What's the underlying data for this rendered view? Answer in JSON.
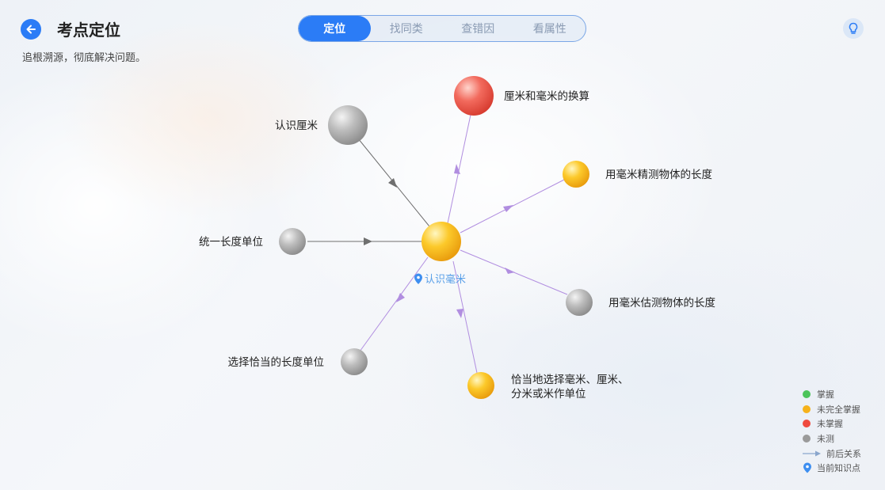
{
  "header": {
    "title": "考点定位",
    "subtitle": "追根溯源，彻底解决问题。",
    "tabs": [
      {
        "label": "定位",
        "active": true
      },
      {
        "label": "找同类",
        "active": false
      },
      {
        "label": "查错因",
        "active": false
      },
      {
        "label": "看属性",
        "active": false
      }
    ]
  },
  "graph": {
    "center": {
      "label": "认识毫米",
      "status": "partial"
    },
    "nodes": [
      {
        "id": "n1",
        "label": "认识厘米",
        "status": "untested",
        "relation": "prerequisite"
      },
      {
        "id": "n2",
        "label": "统一长度单位",
        "status": "untested",
        "relation": "prerequisite"
      },
      {
        "id": "n3",
        "label": "厘米和毫米的换算",
        "status": "not-mastered",
        "relation": "follow-up"
      },
      {
        "id": "n4",
        "label": "用毫米精测物体的长度",
        "status": "partial",
        "relation": "follow-up"
      },
      {
        "id": "n5",
        "label": "用毫米估测物体的长度",
        "status": "untested",
        "relation": "follow-up"
      },
      {
        "id": "n6",
        "label": "恰当地选择毫米、厘米、",
        "label2": "分米或米作单位",
        "status": "partial",
        "relation": "follow-up"
      },
      {
        "id": "n7",
        "label": "选择恰当的长度单位",
        "status": "untested",
        "relation": "follow-up"
      }
    ]
  },
  "legend": [
    {
      "label": "掌握",
      "color": "#4cc45a",
      "kind": "dot"
    },
    {
      "label": "未完全掌握",
      "color": "#f6b21b",
      "kind": "dot"
    },
    {
      "label": "未掌握",
      "color": "#ef4a3f",
      "kind": "dot"
    },
    {
      "label": "未测",
      "color": "#9a9a9a",
      "kind": "dot"
    },
    {
      "label": "前后关系",
      "color": "#8aa6cc",
      "kind": "arrow"
    },
    {
      "label": "当前知识点",
      "color": "#3d8ef0",
      "kind": "pin"
    }
  ]
}
